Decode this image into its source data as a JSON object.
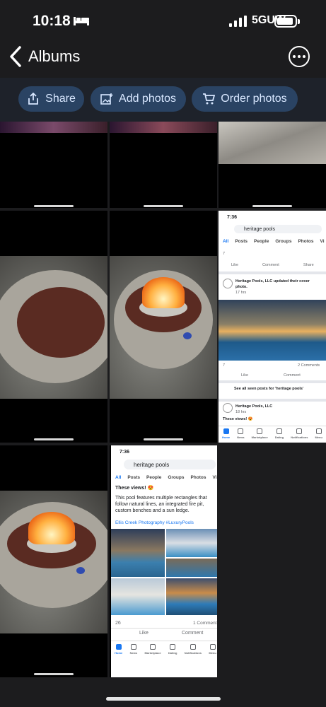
{
  "status_bar": {
    "time": "10:18",
    "network": "5GUW"
  },
  "nav": {
    "back_label": "Albums"
  },
  "actions": {
    "share": "Share",
    "add_photos": "Add photos",
    "order_photos": "Order photos"
  },
  "fb1": {
    "time": "7:36",
    "search": "heritage pools",
    "tabs": [
      "All",
      "Posts",
      "People",
      "Groups",
      "Photos",
      "Vi"
    ],
    "reactions": "7",
    "like": "Like",
    "comment": "Comment",
    "share": "Share",
    "page_name": "Heritage Pools, LLC updated their cover photo.",
    "posted": "17 hrs",
    "reactions2": "7",
    "comments2": "2 Comments",
    "see_all": "See all seen posts for 'heritage pools'",
    "page_name2": "Heritage Pools, LLC",
    "posted2": "18 hrs",
    "snippet": "These views! 😍",
    "nav": [
      "Home",
      "News",
      "Marketplace",
      "Dating",
      "Notifications",
      "Menu"
    ]
  },
  "fb2": {
    "time": "7:36",
    "search": "heritage pools",
    "tabs": [
      "All",
      "Posts",
      "People",
      "Groups",
      "Photos",
      "Vi"
    ],
    "headline": "These views! 😍",
    "body": "This pool features multiple rectangles that follow natural lines, an integrated fire pit, custom benches and a sun ledge.",
    "tags": "Ellis Creek Photography #LuxuryPools",
    "reactions": "26",
    "comments": "1 Comment",
    "like": "Like",
    "comment": "Comment",
    "nav": [
      "Home",
      "News",
      "Marketplace",
      "Dating",
      "Notifications",
      "Menu"
    ]
  },
  "colors": {
    "pill_bg": "#2a4363",
    "pill_text": "#d8e7ff",
    "fb_blue": "#1877f2"
  }
}
